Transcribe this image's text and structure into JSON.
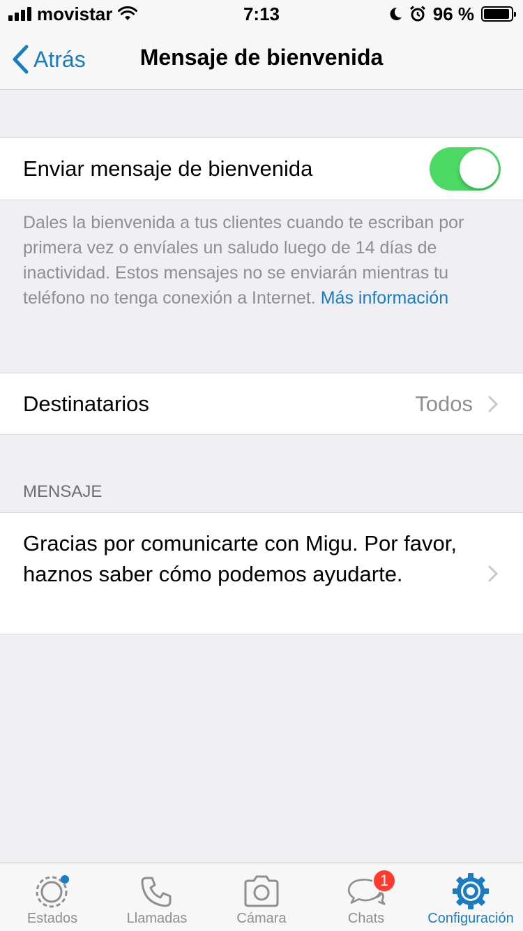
{
  "status_bar": {
    "carrier": "movistar",
    "time": "7:13",
    "battery_percent": "96 %",
    "battery_level": 0.96
  },
  "nav": {
    "back_label": "Atrás",
    "title": "Mensaje de bienvenida"
  },
  "welcome_toggle": {
    "label": "Enviar mensaje de bienvenida",
    "enabled": true
  },
  "footer": {
    "text": "Dales la bienvenida a tus clientes cuando te escriban por primera vez o envíales un saludo luego de 14 días de inactividad. Estos mensajes no se enviarán mientras tu teléfono no tenga conexión a Internet. ",
    "link": "Más información"
  },
  "recipients": {
    "label": "Destinatarios",
    "value": "Todos"
  },
  "message_section": {
    "header": "MENSAJE",
    "text": "Gracias por comunicarte con Migu. Por favor, haznos saber cómo podemos ayudarte."
  },
  "tabs": [
    {
      "label": "Estados",
      "icon": "status-icon"
    },
    {
      "label": "Llamadas",
      "icon": "phone-icon"
    },
    {
      "label": "Cámara",
      "icon": "camera-icon"
    },
    {
      "label": "Chats",
      "icon": "chats-icon",
      "badge": "1"
    },
    {
      "label": "Configuración",
      "icon": "settings-gear-icon",
      "active": true
    }
  ],
  "colors": {
    "accent": "#1a7cc1",
    "toggle_on": "#4cd964",
    "badge": "#ff3b30",
    "background": "#efeff4"
  }
}
